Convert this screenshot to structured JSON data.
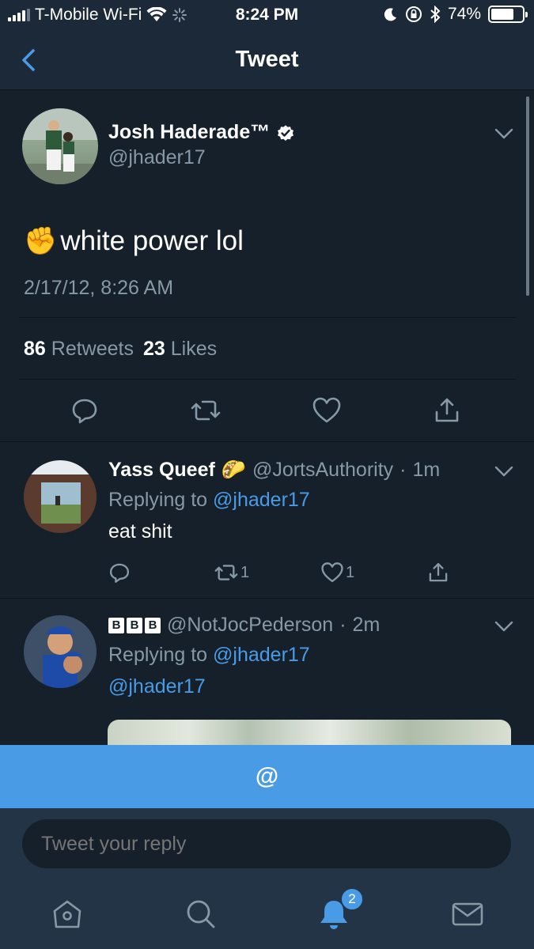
{
  "status_bar": {
    "carrier": "T-Mobile Wi-Fi",
    "time": "8:24 PM",
    "battery": "74%",
    "battery_level": 0.74
  },
  "nav": {
    "title": "Tweet",
    "back_icon": "chevron-left-icon"
  },
  "main_tweet": {
    "name": "Josh Haderade™",
    "handle": "@jhader17",
    "emoji": "✊",
    "text": "white power lol",
    "date": "2/17/12, 8:26 AM",
    "retweets_count": "86",
    "retweets_label": "Retweets",
    "likes_count": "23",
    "likes_label": "Likes"
  },
  "replies": [
    {
      "name": "Yass Queef",
      "name_emoji": "🌮",
      "handle": "@JortsAuthority",
      "time": "1m",
      "replying_label": "Replying to",
      "replying_to": "@jhader17",
      "text": "eat shit",
      "retweets": "1",
      "likes": "1"
    },
    {
      "name_letters": [
        "B",
        "B",
        "B"
      ],
      "handle": "@NotJocPederson",
      "time": "2m",
      "replying_label": "Replying to",
      "replying_to": "@jhader17",
      "text": "@jhader17"
    }
  ],
  "at_bar": {
    "label": "@"
  },
  "composer": {
    "placeholder": "Tweet your reply"
  },
  "tab_bar": {
    "notifications_badge": "2",
    "icons": [
      "home-icon",
      "search-icon",
      "notifications-icon",
      "messages-icon"
    ]
  },
  "colors": {
    "background": "#15202b",
    "bar": "#1c2938",
    "accent": "#4a9be6",
    "muted": "#8899a6"
  }
}
